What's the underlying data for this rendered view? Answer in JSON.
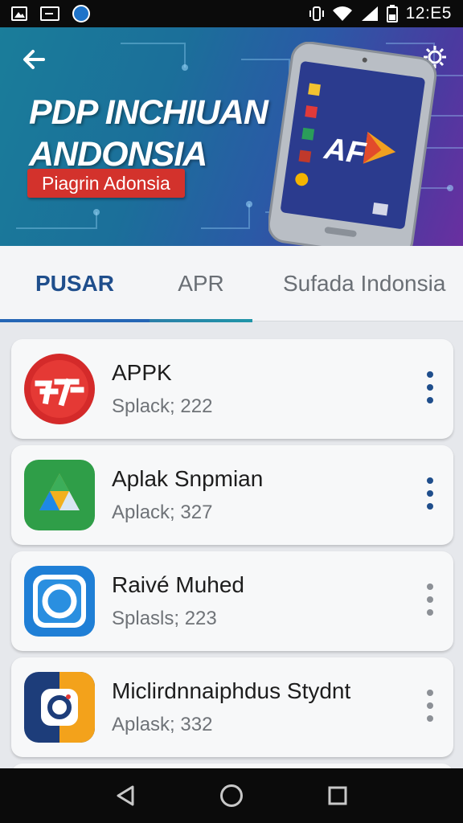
{
  "status_bar": {
    "time": "12:E5",
    "left_icons": [
      "image-icon",
      "message-icon",
      "app-badge-icon"
    ],
    "right_icons": [
      "vibrate-icon",
      "wifi-icon",
      "signal-icon",
      "battery-icon"
    ]
  },
  "banner": {
    "title_line1": "PDP INCHIUAN",
    "title_line2": "ANDONSIA",
    "subtitle": "Piagrin Adonsia",
    "phone_logo": "AF",
    "colors": {
      "subtitle_bg": "#d3322c",
      "gradient_start": "#1a7d9a",
      "gradient_end": "#6a2fa0"
    }
  },
  "tabs": [
    {
      "label": "PUSAR",
      "active": true
    },
    {
      "label": "APR",
      "active": false
    },
    {
      "label": "Sufada Indonsia",
      "active": false
    }
  ],
  "apps": [
    {
      "name": "APPK",
      "detail": "Splack; 222",
      "icon": "red-circle-logo-icon",
      "menu_color": "blue"
    },
    {
      "name": "Aplak Snpmian",
      "detail": "Aplack; 327",
      "icon": "triangle-drive-icon",
      "menu_color": "blue"
    },
    {
      "name": "Raivé Muhed",
      "detail": "Splasls; 223",
      "icon": "blue-camera-icon",
      "menu_color": "grey"
    },
    {
      "name": "Miclirdnnaiphdus Stydnt",
      "detail": "Aplask; 332",
      "icon": "split-color-camera-icon",
      "menu_color": "grey"
    }
  ],
  "nav_bar": {
    "buttons": [
      "back-triangle-icon",
      "home-circle-icon",
      "recents-square-icon"
    ]
  },
  "accent_color": "#1f4e8c"
}
